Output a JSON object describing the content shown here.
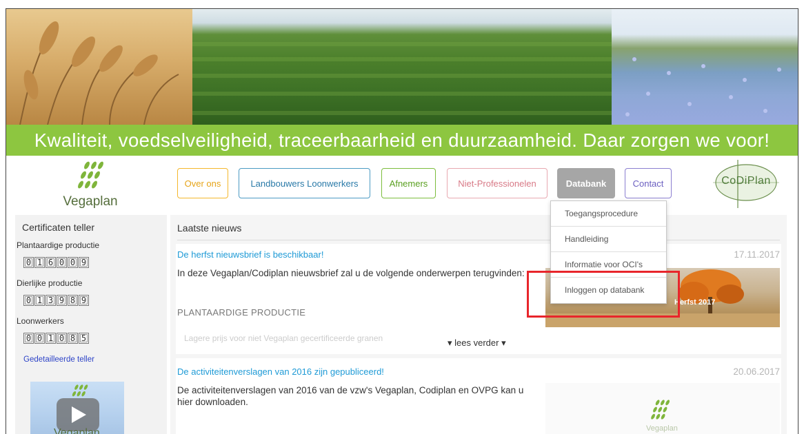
{
  "banner": {
    "tagline": "Kwaliteit, voedselveiligheid, traceerbaarheid en duurzaamheid. Daar zorgen we voor!"
  },
  "logo": {
    "text": "Vegaplan"
  },
  "nav": {
    "items": [
      {
        "label": "Over ons"
      },
      {
        "label": "Landbouwers Loonwerkers"
      },
      {
        "label": "Afnemers"
      },
      {
        "label": "Niet-Professionelen"
      },
      {
        "label": "Databank"
      },
      {
        "label": "Contact"
      }
    ],
    "active": "Databank"
  },
  "codiplan": {
    "text": "CoDiPlan"
  },
  "dropdown": {
    "items": [
      {
        "label": "Toegangsprocedure"
      },
      {
        "label": "Handleiding"
      },
      {
        "label": "Informatie voor OCI's"
      },
      {
        "label": "Inloggen op databank"
      }
    ],
    "highlighted": "Inloggen op databank"
  },
  "sidebar": {
    "title": "Certificaten teller",
    "counters": [
      {
        "label": "Plantaardige productie",
        "digits": [
          "0",
          "1",
          "6",
          "0",
          "0",
          "9"
        ]
      },
      {
        "label": "Dierlijke productie",
        "digits": [
          "0",
          "1",
          "3",
          "9",
          "8",
          "9"
        ]
      },
      {
        "label": "Loonwerkers",
        "digits": [
          "0",
          "0",
          "1",
          "0",
          "8",
          "5"
        ]
      }
    ],
    "link": "Gedetailleerde teller",
    "video_text": "Vegaplan"
  },
  "news": {
    "heading": "Laatste nieuws",
    "items": [
      {
        "title": "De herfst nieuwsbrief is beschikbaar!",
        "date": "17.11.2017",
        "body": "In deze Vegaplan/Codiplan nieuwsbrief zal u de volgende onderwerpen terugvinden:",
        "subheading": "PLANTAARDIGE PRODUCTIE",
        "faded": "Lagere prijs voor niet Vegaplan gecertificeerde granen",
        "more": "lees verder",
        "image_text": "Herfst 2017"
      },
      {
        "title": "De activiteitenverslagen van 2016 zijn gepubliceerd!",
        "date": "20.06.2017",
        "body": "De activiteitenverslagen van 2016 van de vzw's Vegaplan, Codiplan en OVPG kan u hier downloaden.",
        "image_text": "Vegaplan"
      }
    ]
  },
  "colors": {
    "tagline_bg": "#8dc640",
    "link_blue": "#1e9ad6",
    "highlight_red": "#e8252b",
    "databank_bg": "#a6a6a6"
  }
}
